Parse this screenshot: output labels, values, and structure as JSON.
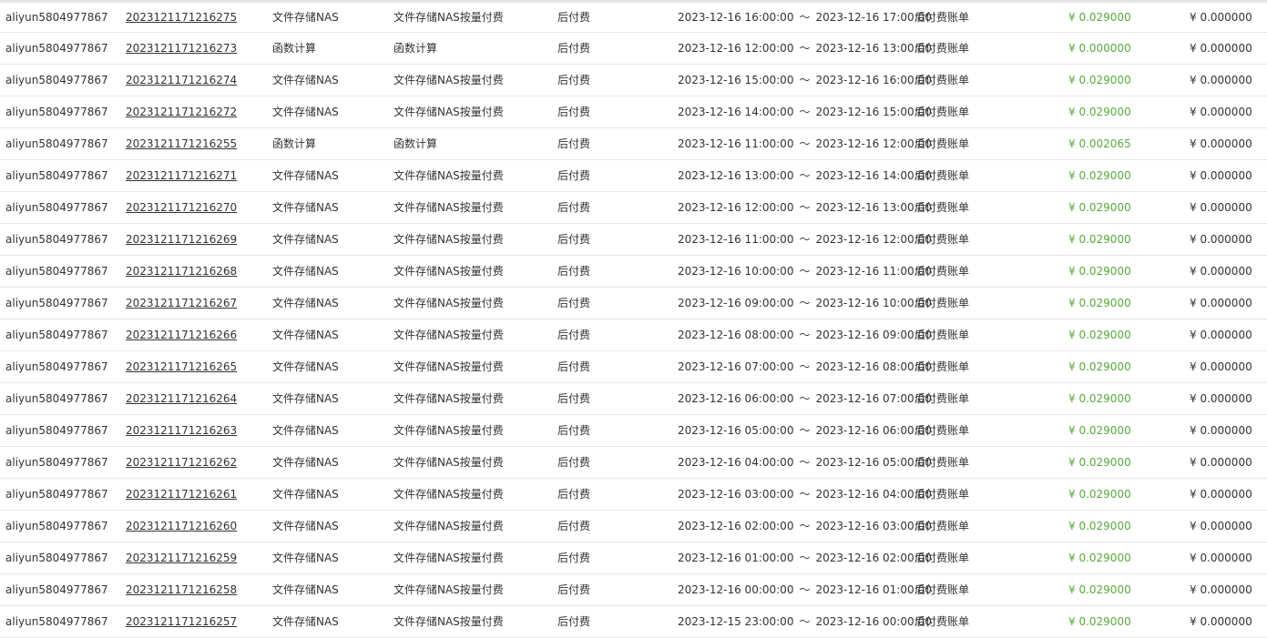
{
  "table": {
    "rows": [
      {
        "account": "aliyun5804977867",
        "bill_no": "2023121171216275",
        "product": "文件存储NAS",
        "detail": "文件存储NAS按量付费",
        "charge_type": "后付费",
        "period_start": "2023-12-16 16:00:00",
        "period_end": "2023-12-16 17:00:00",
        "bill_type": "后付费账单",
        "paid": "¥ 0.029000",
        "owed": "¥ 0.000000"
      },
      {
        "account": "aliyun5804977867",
        "bill_no": "2023121171216273",
        "product": "函数计算",
        "detail": "函数计算",
        "charge_type": "后付费",
        "period_start": "2023-12-16 12:00:00",
        "period_end": "2023-12-16 13:00:00",
        "bill_type": "后付费账单",
        "paid": "¥ 0.000000",
        "owed": "¥ 0.000000"
      },
      {
        "account": "aliyun5804977867",
        "bill_no": "2023121171216274",
        "product": "文件存储NAS",
        "detail": "文件存储NAS按量付费",
        "charge_type": "后付费",
        "period_start": "2023-12-16 15:00:00",
        "period_end": "2023-12-16 16:00:00",
        "bill_type": "后付费账单",
        "paid": "¥ 0.029000",
        "owed": "¥ 0.000000"
      },
      {
        "account": "aliyun5804977867",
        "bill_no": "2023121171216272",
        "product": "文件存储NAS",
        "detail": "文件存储NAS按量付费",
        "charge_type": "后付费",
        "period_start": "2023-12-16 14:00:00",
        "period_end": "2023-12-16 15:00:00",
        "bill_type": "后付费账单",
        "paid": "¥ 0.029000",
        "owed": "¥ 0.000000"
      },
      {
        "account": "aliyun5804977867",
        "bill_no": "2023121171216255",
        "product": "函数计算",
        "detail": "函数计算",
        "charge_type": "后付费",
        "period_start": "2023-12-16 11:00:00",
        "period_end": "2023-12-16 12:00:00",
        "bill_type": "后付费账单",
        "paid": "¥ 0.002065",
        "owed": "¥ 0.000000"
      },
      {
        "account": "aliyun5804977867",
        "bill_no": "2023121171216271",
        "product": "文件存储NAS",
        "detail": "文件存储NAS按量付费",
        "charge_type": "后付费",
        "period_start": "2023-12-16 13:00:00",
        "period_end": "2023-12-16 14:00:00",
        "bill_type": "后付费账单",
        "paid": "¥ 0.029000",
        "owed": "¥ 0.000000"
      },
      {
        "account": "aliyun5804977867",
        "bill_no": "2023121171216270",
        "product": "文件存储NAS",
        "detail": "文件存储NAS按量付费",
        "charge_type": "后付费",
        "period_start": "2023-12-16 12:00:00",
        "period_end": "2023-12-16 13:00:00",
        "bill_type": "后付费账单",
        "paid": "¥ 0.029000",
        "owed": "¥ 0.000000"
      },
      {
        "account": "aliyun5804977867",
        "bill_no": "2023121171216269",
        "product": "文件存储NAS",
        "detail": "文件存储NAS按量付费",
        "charge_type": "后付费",
        "period_start": "2023-12-16 11:00:00",
        "period_end": "2023-12-16 12:00:00",
        "bill_type": "后付费账单",
        "paid": "¥ 0.029000",
        "owed": "¥ 0.000000"
      },
      {
        "account": "aliyun5804977867",
        "bill_no": "2023121171216268",
        "product": "文件存储NAS",
        "detail": "文件存储NAS按量付费",
        "charge_type": "后付费",
        "period_start": "2023-12-16 10:00:00",
        "period_end": "2023-12-16 11:00:00",
        "bill_type": "后付费账单",
        "paid": "¥ 0.029000",
        "owed": "¥ 0.000000"
      },
      {
        "account": "aliyun5804977867",
        "bill_no": "2023121171216267",
        "product": "文件存储NAS",
        "detail": "文件存储NAS按量付费",
        "charge_type": "后付费",
        "period_start": "2023-12-16 09:00:00",
        "period_end": "2023-12-16 10:00:00",
        "bill_type": "后付费账单",
        "paid": "¥ 0.029000",
        "owed": "¥ 0.000000"
      },
      {
        "account": "aliyun5804977867",
        "bill_no": "2023121171216266",
        "product": "文件存储NAS",
        "detail": "文件存储NAS按量付费",
        "charge_type": "后付费",
        "period_start": "2023-12-16 08:00:00",
        "period_end": "2023-12-16 09:00:00",
        "bill_type": "后付费账单",
        "paid": "¥ 0.029000",
        "owed": "¥ 0.000000"
      },
      {
        "account": "aliyun5804977867",
        "bill_no": "2023121171216265",
        "product": "文件存储NAS",
        "detail": "文件存储NAS按量付费",
        "charge_type": "后付费",
        "period_start": "2023-12-16 07:00:00",
        "period_end": "2023-12-16 08:00:00",
        "bill_type": "后付费账单",
        "paid": "¥ 0.029000",
        "owed": "¥ 0.000000"
      },
      {
        "account": "aliyun5804977867",
        "bill_no": "2023121171216264",
        "product": "文件存储NAS",
        "detail": "文件存储NAS按量付费",
        "charge_type": "后付费",
        "period_start": "2023-12-16 06:00:00",
        "period_end": "2023-12-16 07:00:00",
        "bill_type": "后付费账单",
        "paid": "¥ 0.029000",
        "owed": "¥ 0.000000"
      },
      {
        "account": "aliyun5804977867",
        "bill_no": "2023121171216263",
        "product": "文件存储NAS",
        "detail": "文件存储NAS按量付费",
        "charge_type": "后付费",
        "period_start": "2023-12-16 05:00:00",
        "period_end": "2023-12-16 06:00:00",
        "bill_type": "后付费账单",
        "paid": "¥ 0.029000",
        "owed": "¥ 0.000000"
      },
      {
        "account": "aliyun5804977867",
        "bill_no": "2023121171216262",
        "product": "文件存储NAS",
        "detail": "文件存储NAS按量付费",
        "charge_type": "后付费",
        "period_start": "2023-12-16 04:00:00",
        "period_end": "2023-12-16 05:00:00",
        "bill_type": "后付费账单",
        "paid": "¥ 0.029000",
        "owed": "¥ 0.000000"
      },
      {
        "account": "aliyun5804977867",
        "bill_no": "2023121171216261",
        "product": "文件存储NAS",
        "detail": "文件存储NAS按量付费",
        "charge_type": "后付费",
        "period_start": "2023-12-16 03:00:00",
        "period_end": "2023-12-16 04:00:00",
        "bill_type": "后付费账单",
        "paid": "¥ 0.029000",
        "owed": "¥ 0.000000"
      },
      {
        "account": "aliyun5804977867",
        "bill_no": "2023121171216260",
        "product": "文件存储NAS",
        "detail": "文件存储NAS按量付费",
        "charge_type": "后付费",
        "period_start": "2023-12-16 02:00:00",
        "period_end": "2023-12-16 03:00:00",
        "bill_type": "后付费账单",
        "paid": "¥ 0.029000",
        "owed": "¥ 0.000000"
      },
      {
        "account": "aliyun5804977867",
        "bill_no": "2023121171216259",
        "product": "文件存储NAS",
        "detail": "文件存储NAS按量付费",
        "charge_type": "后付费",
        "period_start": "2023-12-16 01:00:00",
        "period_end": "2023-12-16 02:00:00",
        "bill_type": "后付费账单",
        "paid": "¥ 0.029000",
        "owed": "¥ 0.000000"
      },
      {
        "account": "aliyun5804977867",
        "bill_no": "2023121171216258",
        "product": "文件存储NAS",
        "detail": "文件存储NAS按量付费",
        "charge_type": "后付费",
        "period_start": "2023-12-16 00:00:00",
        "period_end": "2023-12-16 01:00:00",
        "bill_type": "后付费账单",
        "paid": "¥ 0.029000",
        "owed": "¥ 0.000000"
      },
      {
        "account": "aliyun5804977867",
        "bill_no": "2023121171216257",
        "product": "文件存储NAS",
        "detail": "文件存储NAS按量付费",
        "charge_type": "后付费",
        "period_start": "2023-12-15 23:00:00",
        "period_end": "2023-12-16 00:00:00",
        "bill_type": "后付费账单",
        "paid": "¥ 0.029000",
        "owed": "¥ 0.000000"
      }
    ],
    "period_separator": "～"
  },
  "colors": {
    "paid_amount": "#59a83e",
    "text": "#333333",
    "row_border": "#e8e8e8"
  }
}
